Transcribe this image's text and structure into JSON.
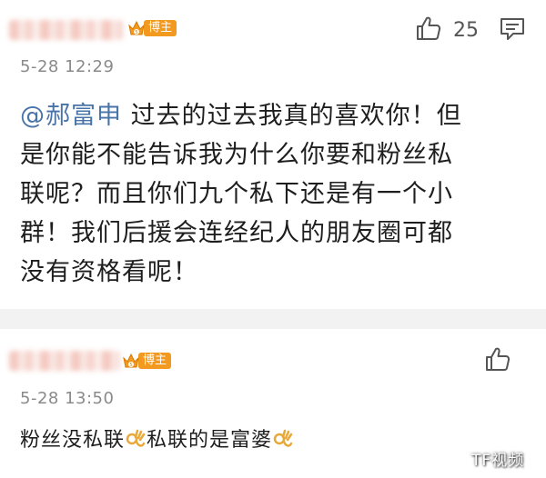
{
  "post": {
    "badge_label": "博主",
    "timestamp": "5-28 12:29",
    "like_count": "25",
    "mention": "@郝富申",
    "text_line1": " 过去的过去我真的喜欢你！但",
    "text_line2": "是你能不能告诉我为什么你要和粉丝私",
    "text_line3": "联呢？而且你们九个私下还是有一个小",
    "text_line4": "群！我们后援会连经纪人的朋友圈可都",
    "text_line5": "没有资格看呢！"
  },
  "reply": {
    "badge_label": "博主",
    "timestamp": "5-28 13:50",
    "text_part1": "粉丝没私联",
    "text_part2": "私联的是富婆"
  },
  "watermark": "TF视频",
  "icons": {
    "like": "thumbs-up-icon",
    "comment": "comment-icon",
    "crown": "crown-icon",
    "ok_hand": "ok-hand-icon"
  },
  "colors": {
    "mention": "#4a74a8",
    "badge": "#f29a1f",
    "timestamp": "#8a8a8a",
    "divider": "#f2f2f2"
  }
}
